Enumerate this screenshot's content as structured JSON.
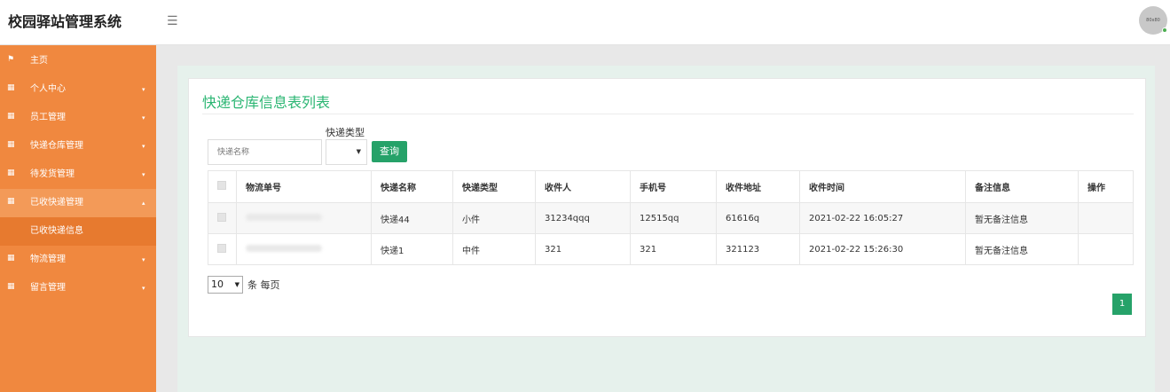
{
  "app": {
    "title": "校园驿站管理系统",
    "avatar_text": "80x80"
  },
  "header": {
    "menu_icon": "hamburger-icon"
  },
  "sidebar": {
    "items": [
      {
        "label": "主页",
        "icon": "flag-icon"
      },
      {
        "label": "个人中心",
        "icon": "grid-icon"
      },
      {
        "label": "员工管理",
        "icon": "grid-icon"
      },
      {
        "label": "快递仓库管理",
        "icon": "grid-icon"
      },
      {
        "label": "待发货管理",
        "icon": "grid-icon"
      },
      {
        "label": "已收快递管理",
        "icon": "grid-icon"
      },
      {
        "label": "已收快递信息",
        "icon": ""
      },
      {
        "label": "物流管理",
        "icon": "grid-icon"
      },
      {
        "label": "留言管理",
        "icon": "grid-icon"
      }
    ]
  },
  "main": {
    "title": "快递仓库信息表列表",
    "search": {
      "placeholder": "快递名称",
      "type_label": "快递类型",
      "query_label": "查询"
    },
    "table": {
      "columns": [
        "物流单号",
        "快递名称",
        "快递类型",
        "收件人",
        "手机号",
        "收件地址",
        "收件时间",
        "备注信息",
        "操作"
      ],
      "rows": [
        [
          "快递44",
          "小件",
          "31234qqq",
          "12515qq",
          "61616q",
          "2021-02-22 16:05:27",
          "暂无备注信息"
        ],
        [
          "快递1",
          "中件",
          "321",
          "321",
          "321123",
          "2021-02-22 15:26:30",
          "暂无备注信息"
        ]
      ]
    },
    "pagination": {
      "page_size": "10",
      "page_size_suffix": "条 每页",
      "current_page": "1"
    }
  },
  "colors": {
    "sidebar": "#f0883f",
    "accent_green": "#26a269",
    "title_green": "#2bb673"
  }
}
